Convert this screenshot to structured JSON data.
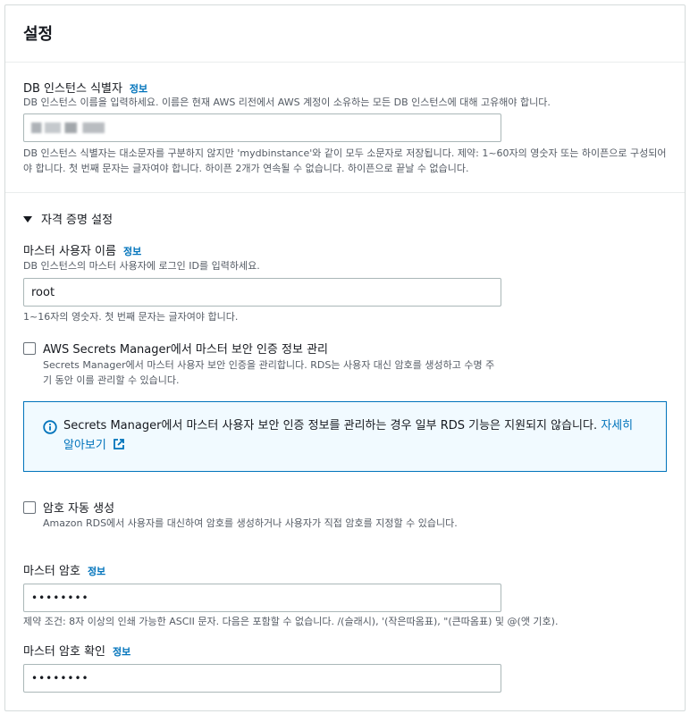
{
  "panel": {
    "title": "설정"
  },
  "db_identifier": {
    "label": "DB 인스턴스 식별자",
    "info": "정보",
    "description": "DB 인스턴스 이름을 입력하세요. 이름은 현재 AWS 리전에서 AWS 계정이 소유하는 모든 DB 인스턴스에 대해 고유해야 합니다.",
    "constraint": "DB 인스턴스 식별자는 대소문자를 구분하지 않지만 'mydbinstance'와 같이 모두 소문자로 저장됩니다. 제약: 1~60자의 영숫자 또는 하이픈으로 구성되어야 합니다. 첫 번째 문자는 글자여야 합니다. 하이픈 2개가 연속될 수 없습니다. 하이픈으로 끝날 수 없습니다."
  },
  "credentials": {
    "section_title": "자격 증명 설정",
    "master_username": {
      "label": "마스터 사용자 이름",
      "info": "정보",
      "description": "DB 인스턴스의 마스터 사용자에 로그인 ID를 입력하세요.",
      "value": "root",
      "constraint": "1~16자의 영숫자. 첫 번째 문자는 글자여야 합니다."
    },
    "secrets_manager": {
      "label": "AWS Secrets Manager에서 마스터 보안 인증 정보 관리",
      "description": "Secrets Manager에서 마스터 사용자 보안 인증을 관리합니다. RDS는 사용자 대신 암호를 생성하고 수명 주기 동안 이를 관리할 수 있습니다."
    },
    "alert": {
      "text": "Secrets Manager에서 마스터 사용자 보안 인증 정보를 관리하는 경우 일부 RDS 기능은 지원되지 않습니다.",
      "link": "자세히 알아보기"
    },
    "auto_password": {
      "label": "암호 자동 생성",
      "description": "Amazon RDS에서 사용자를 대신하여 암호를 생성하거나 사용자가 직접 암호를 지정할 수 있습니다."
    },
    "master_password": {
      "label": "마스터 암호",
      "info": "정보",
      "value": "••••••••",
      "constraint": "제약 조건: 8자 이상의 인쇄 가능한 ASCII 문자. 다음은 포함할 수 없습니다. /(슬래시), '(작은따옴표), \"(큰따옴표) 및 @(앳 기호)."
    },
    "confirm_password": {
      "label": "마스터 암호 확인",
      "info": "정보",
      "value": "••••••••"
    }
  },
  "colors": {
    "link": "#0073bb",
    "border": "#aab7b8",
    "alert_bg": "#f1faff"
  }
}
